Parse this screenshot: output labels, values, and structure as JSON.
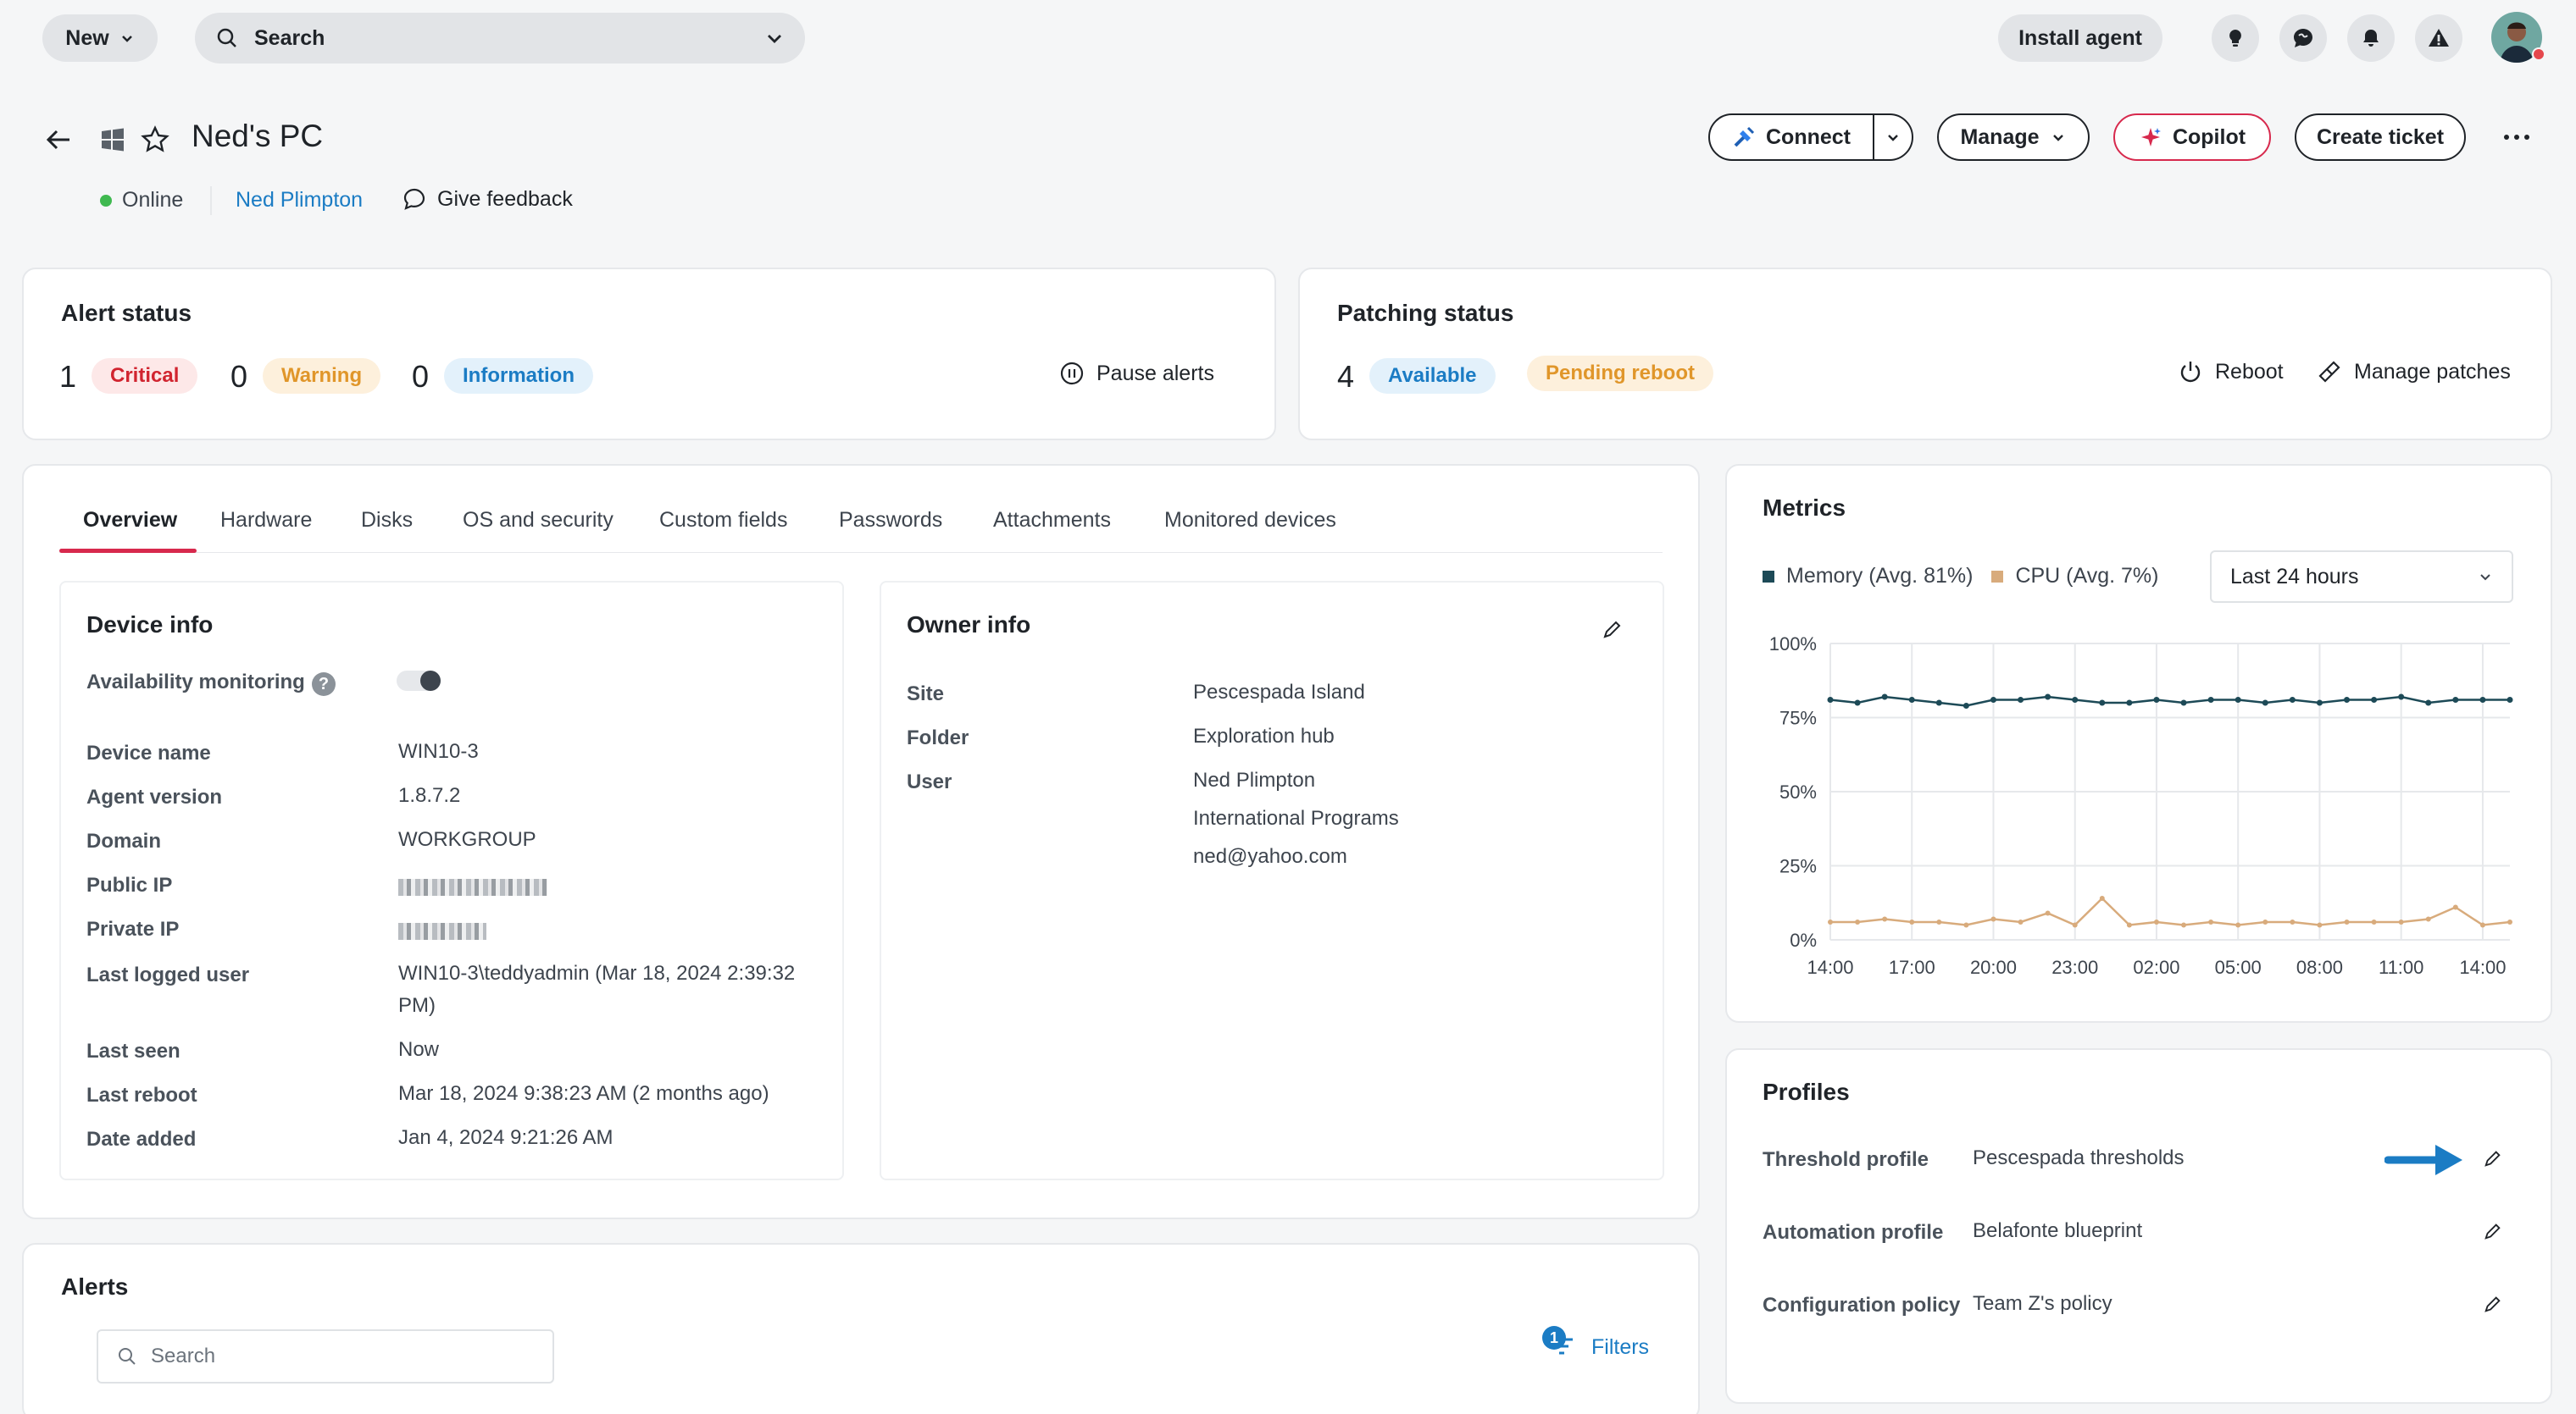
{
  "topbar": {
    "new_label": "New",
    "search_label": "Search",
    "install_label": "Install agent"
  },
  "device": {
    "title": "Ned's PC",
    "status": "Online",
    "owner": "Ned Plimpton",
    "feedback": "Give feedback",
    "status_color": "#3fb950"
  },
  "header_actions": {
    "connect": "Connect",
    "manage": "Manage",
    "copilot": "Copilot",
    "create_ticket": "Create ticket"
  },
  "alert_status": {
    "title": "Alert status",
    "critical_count": "1",
    "critical_label": "Critical",
    "warning_count": "0",
    "warning_label": "Warning",
    "info_count": "0",
    "info_label": "Information",
    "pause": "Pause alerts"
  },
  "patching_status": {
    "title": "Patching status",
    "available_count": "4",
    "available_label": "Available",
    "pending_label": "Pending reboot",
    "reboot": "Reboot",
    "manage_patches": "Manage patches"
  },
  "tabs": [
    "Overview",
    "Hardware",
    "Disks",
    "OS and security",
    "Custom fields",
    "Passwords",
    "Attachments",
    "Monitored devices"
  ],
  "device_info": {
    "title": "Device info",
    "availability_label": "Availability monitoring",
    "rows": [
      {
        "label": "Device name",
        "value": "WIN10-3"
      },
      {
        "label": "Agent version",
        "value": "1.8.7.2"
      },
      {
        "label": "Domain",
        "value": "WORKGROUP"
      },
      {
        "label": "Public IP",
        "value": ""
      },
      {
        "label": "Private IP",
        "value": ""
      },
      {
        "label": "Last logged user",
        "value": "WIN10-3\\teddyadmin (Mar 18, 2024 2:39:32 PM)"
      },
      {
        "label": "Last seen",
        "value": "Now"
      },
      {
        "label": "Last reboot",
        "value": "Mar 18, 2024 9:38:23 AM (2 months ago)"
      },
      {
        "label": "Date added",
        "value": "Jan 4, 2024 9:21:26 AM"
      }
    ]
  },
  "owner_info": {
    "title": "Owner info",
    "site_label": "Site",
    "site": "Pescespada Island",
    "folder_label": "Folder",
    "folder": "Exploration hub",
    "user_label": "User",
    "user": "Ned Plimpton",
    "department": "International Programs",
    "email": "ned@yahoo.com"
  },
  "metrics": {
    "title": "Metrics",
    "memory_legend": "Memory (Avg. 81%)",
    "cpu_legend": "CPU (Avg. 7%)",
    "range": "Last 24 hours",
    "memory_color": "#1d4a57",
    "cpu_color": "#d8ab7c"
  },
  "chart_data": {
    "type": "line",
    "x": [
      "14:00",
      "15:00",
      "16:00",
      "17:00",
      "18:00",
      "19:00",
      "20:00",
      "21:00",
      "22:00",
      "23:00",
      "00:00",
      "01:00",
      "02:00",
      "03:00",
      "04:00",
      "05:00",
      "06:00",
      "07:00",
      "08:00",
      "09:00",
      "10:00",
      "11:00",
      "12:00",
      "13:00",
      "14:00",
      "15:00"
    ],
    "xticks": [
      "14:00",
      "17:00",
      "20:00",
      "23:00",
      "02:00",
      "05:00",
      "08:00",
      "11:00",
      "14:00"
    ],
    "yticks": [
      "100%",
      "75%",
      "50%",
      "25%",
      "0%"
    ],
    "ylim": [
      0,
      100
    ],
    "series": [
      {
        "name": "Memory (Avg. 81%)",
        "values": [
          81,
          80,
          82,
          81,
          80,
          79,
          81,
          81,
          82,
          81,
          80,
          80,
          81,
          80,
          81,
          81,
          80,
          81,
          80,
          81,
          81,
          82,
          80,
          81,
          81,
          81
        ]
      },
      {
        "name": "CPU (Avg. 7%)",
        "values": [
          6,
          6,
          7,
          6,
          6,
          5,
          7,
          6,
          9,
          5,
          14,
          5,
          6,
          5,
          6,
          5,
          6,
          6,
          5,
          6,
          6,
          6,
          7,
          11,
          5,
          6
        ]
      }
    ]
  },
  "profiles": {
    "title": "Profiles",
    "rows": [
      {
        "label": "Threshold profile",
        "value": "Pescespada thresholds"
      },
      {
        "label": "Automation profile",
        "value": "Belafonte blueprint"
      },
      {
        "label": "Configuration policy",
        "value": "Team Z's policy"
      }
    ]
  },
  "alerts": {
    "title": "Alerts",
    "search_placeholder": "Search",
    "filter_label": "Filters",
    "filter_count": "1"
  }
}
